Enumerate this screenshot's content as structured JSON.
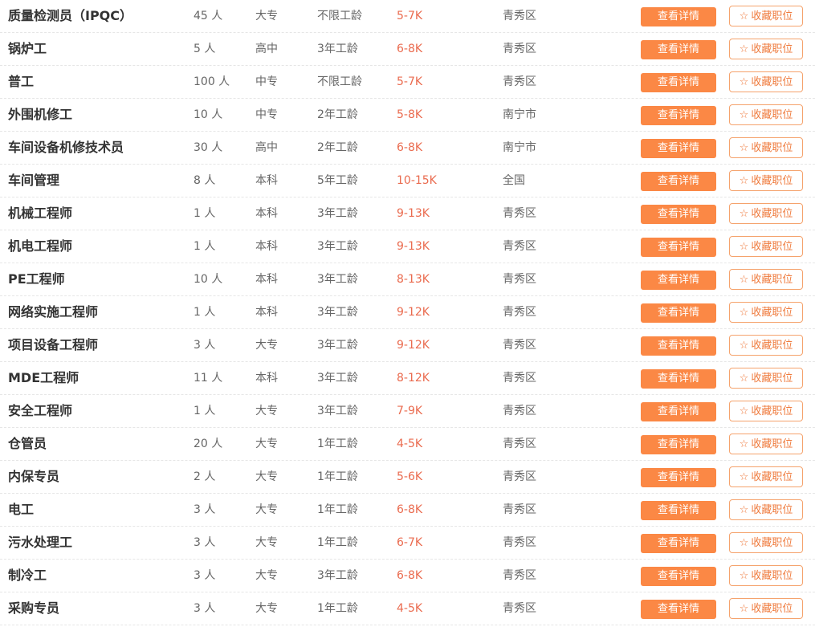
{
  "buttons": {
    "detail_label": "查看详情",
    "favorite_label": "收藏职位",
    "favorite_icon": "star-outline-icon"
  },
  "colors": {
    "salary": "#ea6b4f",
    "detail_button_bg": "#fb8845",
    "favorite_border": "#f5a36d"
  },
  "jobs": [
    {
      "title": "质量检测员（IPQC）",
      "count": "45 人",
      "education": "大专",
      "experience": "不限工龄",
      "salary": "5-7K",
      "location": "青秀区"
    },
    {
      "title": "锅炉工",
      "count": "5 人",
      "education": "高中",
      "experience": "3年工龄",
      "salary": "6-8K",
      "location": "青秀区"
    },
    {
      "title": "普工",
      "count": "100 人",
      "education": "中专",
      "experience": "不限工龄",
      "salary": "5-7K",
      "location": "青秀区"
    },
    {
      "title": "外围机修工",
      "count": "10 人",
      "education": "中专",
      "experience": "2年工龄",
      "salary": "5-8K",
      "location": "南宁市"
    },
    {
      "title": "车间设备机修技术员",
      "count": "30 人",
      "education": "高中",
      "experience": "2年工龄",
      "salary": "6-8K",
      "location": "南宁市"
    },
    {
      "title": "车间管理",
      "count": "8 人",
      "education": "本科",
      "experience": "5年工龄",
      "salary": "10-15K",
      "location": "全国"
    },
    {
      "title": "机械工程师",
      "count": "1 人",
      "education": "本科",
      "experience": "3年工龄",
      "salary": "9-13K",
      "location": "青秀区"
    },
    {
      "title": "机电工程师",
      "count": "1 人",
      "education": "本科",
      "experience": "3年工龄",
      "salary": "9-13K",
      "location": "青秀区"
    },
    {
      "title": "PE工程师",
      "count": "10 人",
      "education": "本科",
      "experience": "3年工龄",
      "salary": "8-13K",
      "location": "青秀区"
    },
    {
      "title": "网络实施工程师",
      "count": "1 人",
      "education": "本科",
      "experience": "3年工龄",
      "salary": "9-12K",
      "location": "青秀区"
    },
    {
      "title": "项目设备工程师",
      "count": "3 人",
      "education": "大专",
      "experience": "3年工龄",
      "salary": "9-12K",
      "location": "青秀区"
    },
    {
      "title": "MDE工程师",
      "count": "11 人",
      "education": "本科",
      "experience": "3年工龄",
      "salary": "8-12K",
      "location": "青秀区"
    },
    {
      "title": "安全工程师",
      "count": "1 人",
      "education": "大专",
      "experience": "3年工龄",
      "salary": "7-9K",
      "location": "青秀区"
    },
    {
      "title": "仓管员",
      "count": "20 人",
      "education": "大专",
      "experience": "1年工龄",
      "salary": "4-5K",
      "location": "青秀区"
    },
    {
      "title": "内保专员",
      "count": "2 人",
      "education": "大专",
      "experience": "1年工龄",
      "salary": "5-6K",
      "location": "青秀区"
    },
    {
      "title": "电工",
      "count": "3 人",
      "education": "大专",
      "experience": "1年工龄",
      "salary": "6-8K",
      "location": "青秀区"
    },
    {
      "title": "污水处理工",
      "count": "3 人",
      "education": "大专",
      "experience": "1年工龄",
      "salary": "6-7K",
      "location": "青秀区"
    },
    {
      "title": "制冷工",
      "count": "3 人",
      "education": "大专",
      "experience": "3年工龄",
      "salary": "6-8K",
      "location": "青秀区"
    },
    {
      "title": "采购专员",
      "count": "3 人",
      "education": "大专",
      "experience": "1年工龄",
      "salary": "4-5K",
      "location": "青秀区"
    }
  ]
}
